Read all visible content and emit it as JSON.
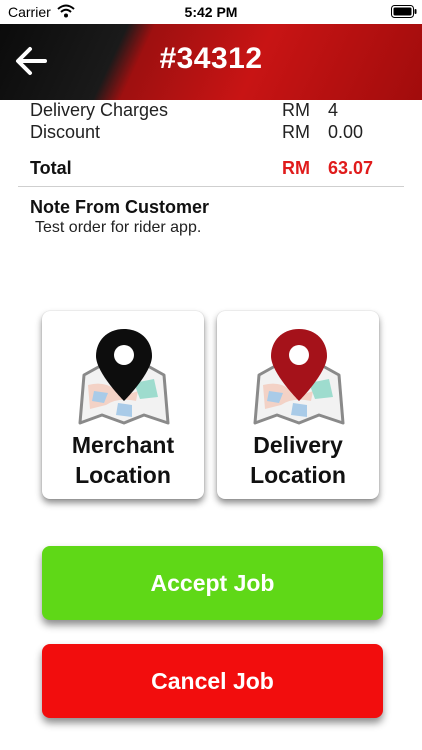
{
  "status_bar": {
    "carrier": "Carrier",
    "time": "5:42 PM",
    "icons": [
      "wifi-icon",
      "battery-icon"
    ]
  },
  "header": {
    "back_icon": "arrow-left-icon",
    "order_number": "#34312"
  },
  "summary": {
    "rows": [
      {
        "label": "Delivery Charges",
        "currency": "RM",
        "amount": "4"
      },
      {
        "label": "Discount",
        "currency": "RM",
        "amount": "0.00"
      }
    ],
    "total": {
      "label": "Total",
      "currency": "RM",
      "amount": "63.07"
    }
  },
  "note": {
    "title": "Note From Customer",
    "text": "Test order for rider app."
  },
  "locations": {
    "merchant": {
      "line1": "Merchant",
      "line2": "Location",
      "icon": "map-pin-black-icon"
    },
    "delivery": {
      "line1": "Delivery",
      "line2": "Location",
      "icon": "map-pin-red-icon"
    }
  },
  "actions": {
    "accept_label": "Accept Job",
    "cancel_label": "Cancel Job"
  },
  "colors": {
    "header_red": "#c81414",
    "accent_red": "#e01b1b",
    "accept_green": "#5fd817",
    "cancel_red": "#f20d0d"
  }
}
